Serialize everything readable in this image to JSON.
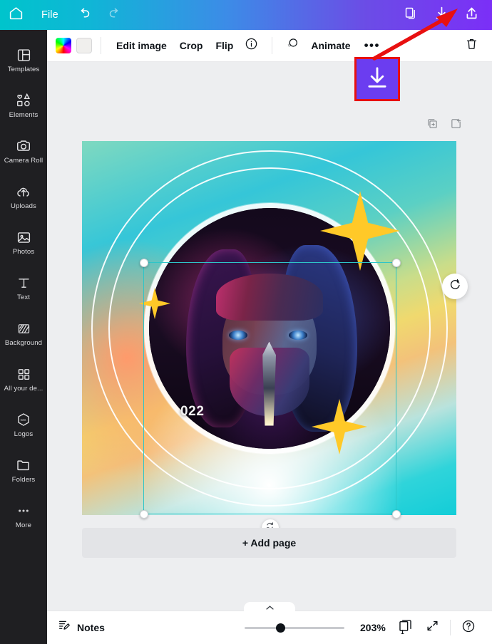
{
  "header": {
    "home_icon": "home-icon",
    "file_label": "File",
    "undo_icon": "undo-icon",
    "redo_icon": "redo-icon",
    "duplicate_icon": "copy-pages-icon",
    "download_icon": "download-icon",
    "share_icon": "share-icon",
    "gradient_from": "#00c4cc",
    "gradient_to": "#7b2ff7"
  },
  "sidebar": {
    "items": [
      {
        "label": "Templates",
        "icon": "templates-icon"
      },
      {
        "label": "Elements",
        "icon": "elements-icon"
      },
      {
        "label": "Camera Roll",
        "icon": "camera-icon"
      },
      {
        "label": "Uploads",
        "icon": "upload-cloud-icon"
      },
      {
        "label": "Photos",
        "icon": "photo-icon"
      },
      {
        "label": "Text",
        "icon": "text-icon"
      },
      {
        "label": "Background",
        "icon": "background-icon"
      },
      {
        "label": "All your de...",
        "icon": "grid-icon"
      },
      {
        "label": "Logos",
        "icon": "logos-icon"
      },
      {
        "label": "Folders",
        "icon": "folder-icon"
      },
      {
        "label": "More",
        "icon": "more-dots-icon"
      }
    ]
  },
  "toolbar": {
    "color_swatch": "rainbow-gradient-swatch",
    "plain_swatch": "plain-color-swatch",
    "edit_image": "Edit image",
    "crop": "Crop",
    "flip": "Flip",
    "info_icon": "info-icon",
    "animate_icon": "animate-icon",
    "animate": "Animate",
    "more": "•••",
    "delete_icon": "trash-icon"
  },
  "page_tools": {
    "duplicate_page_icon": "duplicate-page-icon",
    "add_page_icon": "add-page-icon"
  },
  "canvas": {
    "year_text": "022",
    "magic_icon": "regenerate-icon",
    "rotate_icon": "rotate-icon",
    "selection_color": "#2ec5c8",
    "star_color": "#ffc928"
  },
  "add_page": {
    "label": "+ Add page"
  },
  "bottom_bar": {
    "notes_icon": "notes-icon",
    "notes_label": "Notes",
    "zoom_level": "203%",
    "page_number": "1",
    "pages_icon": "pages-icon",
    "fullscreen_icon": "expand-icon",
    "help_icon": "help-icon",
    "collapse_icon": "chevron-up-icon"
  },
  "annotation": {
    "highlight_icon": "download-icon",
    "box_color": "#6b3df0",
    "border_color": "#e81010",
    "arrow_color": "#e81010"
  }
}
